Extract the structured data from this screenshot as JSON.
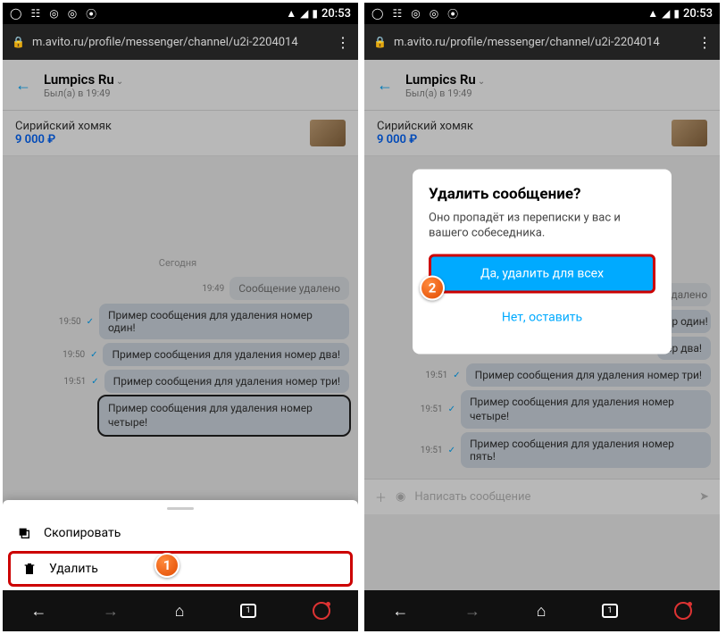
{
  "status": {
    "time": "20:53"
  },
  "url": "m.avito.ru/profile/messenger/channel/u2i-2204014",
  "chat": {
    "title": "Lumpics Ru",
    "subtitle": "Был(а) в 19:49",
    "listing_title": "Сирийский хомяк",
    "listing_price": "9 000 ₽",
    "date_label": "Сегодня",
    "deleted_label": "Сообщение удалено",
    "deleted_ts": "19:49",
    "msgs": [
      {
        "ts": "19:50",
        "text": "Пример сообщения для удаления номер один!"
      },
      {
        "ts": "19:50",
        "text": "Пример сообщения для удаления номер два!"
      },
      {
        "ts": "19:51",
        "text": "Пример сообщения для удаления номер три!"
      },
      {
        "ts": "19:51",
        "text": "Пример сообщения для удаления номер четыре!"
      },
      {
        "ts": "19:51",
        "text": "Пример сообщения для удаления номер пять!"
      }
    ],
    "compose_placeholder": "Написать сообщение"
  },
  "sheet": {
    "copy": "Скопировать",
    "delete": "Удалить"
  },
  "dialog": {
    "title": "Удалить сообщение?",
    "body": "Оно пропадёт из переписки у вас и вашего собеседника.",
    "confirm": "Да, удалить для всех",
    "cancel": "Нет, оставить"
  },
  "steps": {
    "one": "1",
    "two": "2"
  },
  "nav": {
    "tab_count": "1"
  }
}
